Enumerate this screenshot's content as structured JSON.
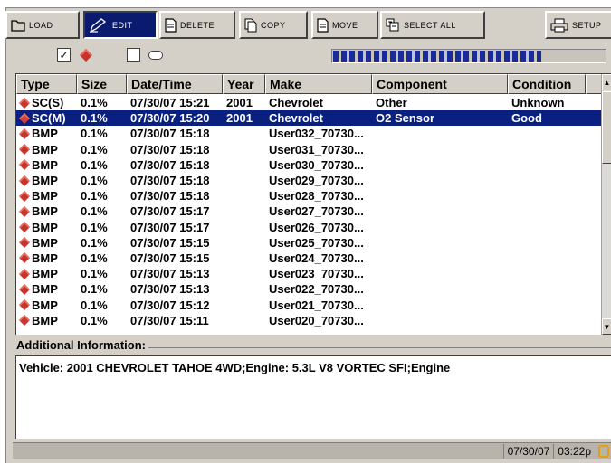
{
  "toolbar": {
    "buttons": [
      {
        "label": "LOAD",
        "icon": "folder-icon"
      },
      {
        "label": "EDIT",
        "icon": "pencil-edit-icon"
      },
      {
        "label": "DELETE",
        "icon": "document-delete-icon"
      },
      {
        "label": "COPY",
        "icon": "document-copy-icon"
      },
      {
        "label": "MOVE",
        "icon": "document-move-icon"
      },
      {
        "label": "SELECT ALL",
        "icon": "select-all-icon"
      },
      {
        "label": "SETUP",
        "icon": "printer-setup-icon"
      }
    ],
    "active": "EDIT"
  },
  "filters": {
    "scan_checked": true,
    "scan_icon": "diamond-scan-icon",
    "other_checked": false,
    "other_icon": "pill-icon",
    "progress": 0.76
  },
  "table": {
    "columns": [
      "Type",
      "Size",
      "Date/Time",
      "Year",
      "Make",
      "Component",
      "Condition"
    ],
    "rows": [
      {
        "type": "SC(S)",
        "size": "0.1%",
        "datetime": "07/30/07 15:21",
        "year": "2001",
        "make": "Chevrolet",
        "component": "Other",
        "condition": "Unknown",
        "selected": false
      },
      {
        "type": "SC(M)",
        "size": "0.1%",
        "datetime": "07/30/07 15:20",
        "year": "2001",
        "make": "Chevrolet",
        "component": "O2 Sensor",
        "condition": "Good",
        "selected": true
      },
      {
        "type": "BMP",
        "size": "0.1%",
        "datetime": "07/30/07 15:18",
        "year": "",
        "make": "User032_70730...",
        "component": "",
        "condition": "",
        "selected": false
      },
      {
        "type": "BMP",
        "size": "0.1%",
        "datetime": "07/30/07 15:18",
        "year": "",
        "make": "User031_70730...",
        "component": "",
        "condition": "",
        "selected": false
      },
      {
        "type": "BMP",
        "size": "0.1%",
        "datetime": "07/30/07 15:18",
        "year": "",
        "make": "User030_70730...",
        "component": "",
        "condition": "",
        "selected": false
      },
      {
        "type": "BMP",
        "size": "0.1%",
        "datetime": "07/30/07 15:18",
        "year": "",
        "make": "User029_70730...",
        "component": "",
        "condition": "",
        "selected": false
      },
      {
        "type": "BMP",
        "size": "0.1%",
        "datetime": "07/30/07 15:18",
        "year": "",
        "make": "User028_70730...",
        "component": "",
        "condition": "",
        "selected": false
      },
      {
        "type": "BMP",
        "size": "0.1%",
        "datetime": "07/30/07 15:17",
        "year": "",
        "make": "User027_70730...",
        "component": "",
        "condition": "",
        "selected": false
      },
      {
        "type": "BMP",
        "size": "0.1%",
        "datetime": "07/30/07 15:17",
        "year": "",
        "make": "User026_70730...",
        "component": "",
        "condition": "",
        "selected": false
      },
      {
        "type": "BMP",
        "size": "0.1%",
        "datetime": "07/30/07 15:15",
        "year": "",
        "make": "User025_70730...",
        "component": "",
        "condition": "",
        "selected": false
      },
      {
        "type": "BMP",
        "size": "0.1%",
        "datetime": "07/30/07 15:15",
        "year": "",
        "make": "User024_70730...",
        "component": "",
        "condition": "",
        "selected": false
      },
      {
        "type": "BMP",
        "size": "0.1%",
        "datetime": "07/30/07 15:13",
        "year": "",
        "make": "User023_70730...",
        "component": "",
        "condition": "",
        "selected": false
      },
      {
        "type": "BMP",
        "size": "0.1%",
        "datetime": "07/30/07 15:13",
        "year": "",
        "make": "User022_70730...",
        "component": "",
        "condition": "",
        "selected": false
      },
      {
        "type": "BMP",
        "size": "0.1%",
        "datetime": "07/30/07 15:12",
        "year": "",
        "make": "User021_70730...",
        "component": "",
        "condition": "",
        "selected": false
      },
      {
        "type": "BMP",
        "size": "0.1%",
        "datetime": "07/30/07 15:11",
        "year": "",
        "make": "User020_70730...",
        "component": "",
        "condition": "",
        "selected": false
      }
    ]
  },
  "info": {
    "legend": "Additional Information:",
    "text": "Vehicle: 2001 CHEVROLET TAHOE 4WD;Engine: 5.3L V8 VORTEC SFI;Engine"
  },
  "status": {
    "date": "07/30/07",
    "time": "03:22p"
  },
  "colors": {
    "selection": "#0a2080",
    "face": "#d4d0c8",
    "active_button": "#0a1a6e",
    "diamond": "#c8342c"
  }
}
